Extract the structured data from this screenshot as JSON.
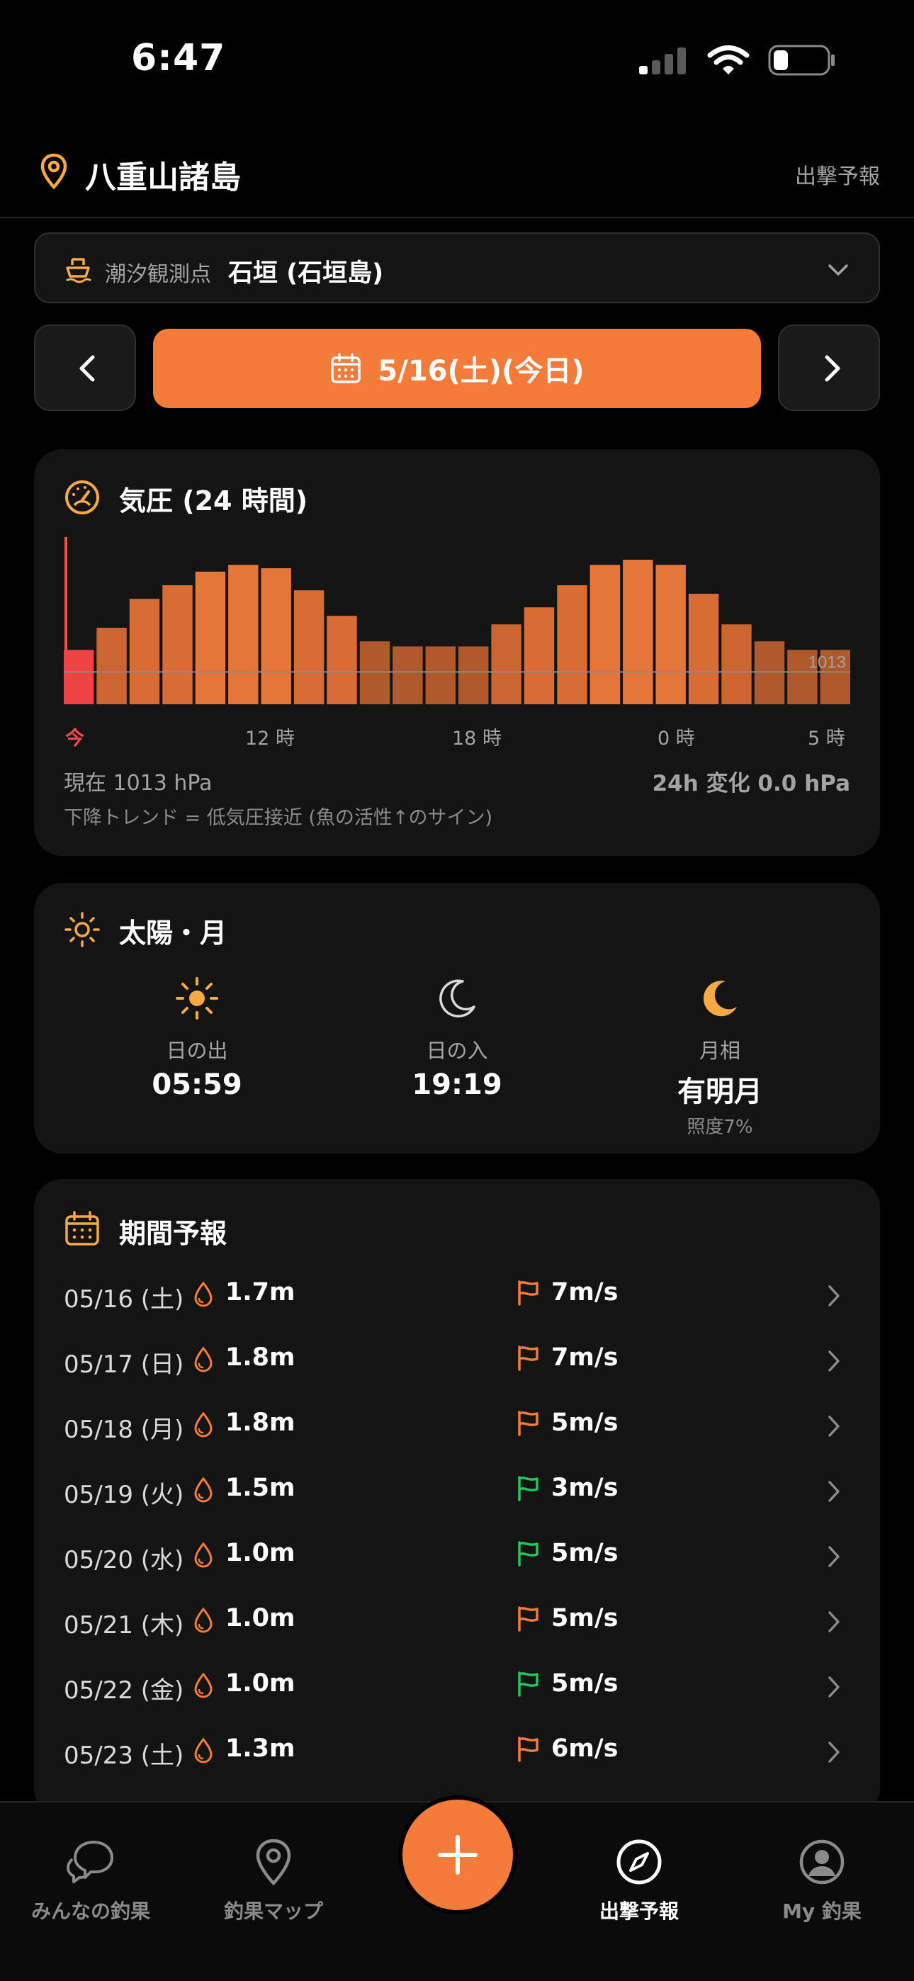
{
  "status_bar": {
    "time": "6:47"
  },
  "header": {
    "title": "八重山諸島",
    "action": "出撃予報"
  },
  "station": {
    "label": "潮汐観測点",
    "value": "石垣 (石垣島)"
  },
  "date_nav": {
    "current": "5/16(土)(今日)"
  },
  "colors": {
    "accent": "#f47b3a",
    "green": "#22c55e",
    "now_red": "#ff4a4a"
  },
  "pressure": {
    "title": "気圧 (24 時間)",
    "current": "現在 1013 hPa",
    "change": "24h 変化 0.0 hPa",
    "note": "下降トレンド = 低気圧接近 (魚の活性↑のサイン)",
    "ref_label": "1013",
    "ticks": [
      "今",
      "12 時",
      "18 時",
      "0 時",
      "5 時"
    ]
  },
  "chart_data": {
    "type": "bar",
    "title": "気圧 (24 時間)",
    "values": [
      0.32,
      0.45,
      0.62,
      0.7,
      0.78,
      0.82,
      0.8,
      0.67,
      0.52,
      0.37,
      0.34,
      0.34,
      0.34,
      0.47,
      0.57,
      0.7,
      0.82,
      0.85,
      0.82,
      0.65,
      0.47,
      0.37,
      0.32,
      0.32
    ],
    "reference_line": 0.24,
    "ticks": [
      "今",
      "12 時",
      "18 時",
      "0 時",
      "5 時"
    ],
    "grid": false
  },
  "sunmoon": {
    "title": "太陽・月",
    "sunrise_label": "日の出",
    "sunrise": "05:59",
    "sunset_label": "日の入",
    "sunset": "19:19",
    "moon_label": "月相",
    "moon": "有明月",
    "moon_sub": "照度7%"
  },
  "forecast": {
    "title": "期間予報",
    "rows": [
      {
        "date": "05/16 (土)",
        "wave": "1.7m",
        "wind": "7m/s",
        "flag": "orange"
      },
      {
        "date": "05/17 (日)",
        "wave": "1.8m",
        "wind": "7m/s",
        "flag": "orange"
      },
      {
        "date": "05/18 (月)",
        "wave": "1.8m",
        "wind": "5m/s",
        "flag": "orange"
      },
      {
        "date": "05/19 (火)",
        "wave": "1.5m",
        "wind": "3m/s",
        "flag": "green"
      },
      {
        "date": "05/20 (水)",
        "wave": "1.0m",
        "wind": "5m/s",
        "flag": "green"
      },
      {
        "date": "05/21 (木)",
        "wave": "1.0m",
        "wind": "5m/s",
        "flag": "orange"
      },
      {
        "date": "05/22 (金)",
        "wave": "1.0m",
        "wind": "5m/s",
        "flag": "green"
      },
      {
        "date": "05/23 (土)",
        "wave": "1.3m",
        "wind": "6m/s",
        "flag": "orange"
      }
    ]
  },
  "tabs": {
    "community": "みんなの釣果",
    "map": "釣果マップ",
    "forecast": "出撃予報",
    "my": "My 釣果"
  }
}
